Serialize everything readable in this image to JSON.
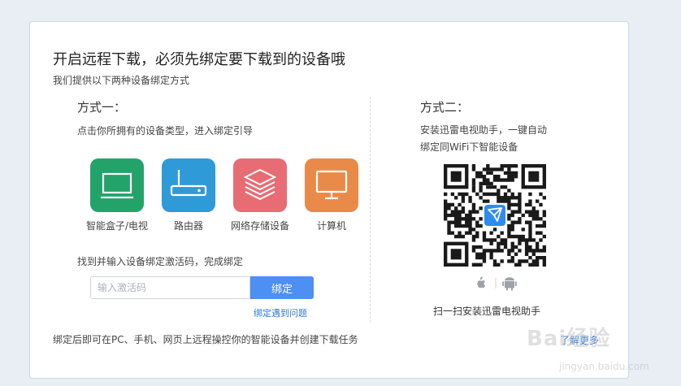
{
  "header": {
    "title": "开启远程下载，必须先绑定要下载到的设备哦",
    "subtitle": "我们提供以下两种设备绑定方式"
  },
  "method1": {
    "title": "方式一：",
    "desc": "点击你所拥有的设备类型，进入绑定引导",
    "devices": [
      {
        "label": "智能盒子/电视",
        "icon": "tv-icon",
        "color": "#23a36a"
      },
      {
        "label": "路由器",
        "icon": "router-icon",
        "color": "#2f9ad8"
      },
      {
        "label": "网络存储设备",
        "icon": "storage-icon",
        "color": "#e86c73"
      },
      {
        "label": "计算机",
        "icon": "monitor-icon",
        "color": "#ea8a48"
      }
    ],
    "bind_text": "找到并输入设备绑定激活码，完成绑定",
    "input_placeholder": "输入激活码",
    "bind_button": "绑定",
    "help_link": "绑定遇到问题"
  },
  "method2": {
    "title": "方式二：",
    "desc_line1": "安装迅雷电视助手，一键自动",
    "desc_line2": "绑定同WiFi下智能设备",
    "qr_caption": "扫一扫安装迅雷电视助手",
    "os_icons": [
      "apple-icon",
      "android-icon"
    ]
  },
  "footer": {
    "text": "绑定后即可在PC、手机、网页上远程操控你的智能设备并创建下载任务",
    "more_link": "了解更多"
  },
  "watermark": {
    "line1": "Bai经验",
    "line2": "jingyan.baidu.com"
  },
  "colors": {
    "accent": "#4d8ff2",
    "link": "#3178d6"
  }
}
